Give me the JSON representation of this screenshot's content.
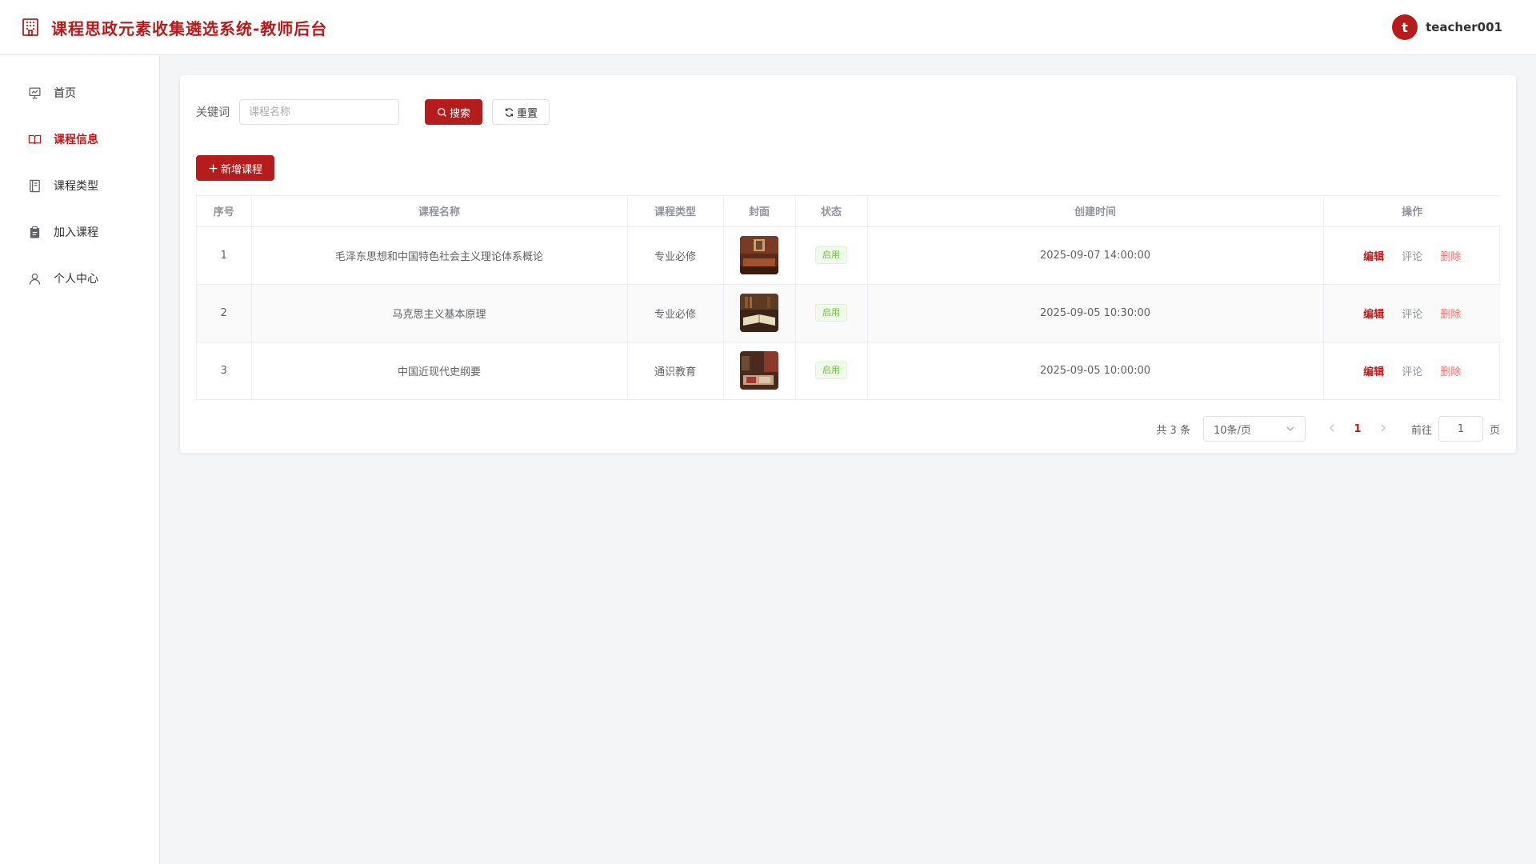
{
  "header": {
    "title": "课程思政元素收集遴选系统-教师后台",
    "avatar_letter": "t",
    "username": "teacher001"
  },
  "sidebar": {
    "items": [
      {
        "label": "首页",
        "icon": "presentation-icon",
        "active": false
      },
      {
        "label": "课程信息",
        "icon": "book-open-icon",
        "active": true
      },
      {
        "label": "课程类型",
        "icon": "notebook-icon",
        "active": false
      },
      {
        "label": "加入课程",
        "icon": "clipboard-icon",
        "active": false
      },
      {
        "label": "个人中心",
        "icon": "user-icon",
        "active": false
      }
    ]
  },
  "search": {
    "label": "关键词",
    "placeholder": "课程名称",
    "value": "",
    "search_button": "搜索",
    "reset_button": "重置"
  },
  "actions": {
    "add_button": "新增课程"
  },
  "table": {
    "headers": [
      "序号",
      "课程名称",
      "课程类型",
      "封面",
      "状态",
      "创建时间",
      "操作"
    ],
    "rows": [
      {
        "index": "1",
        "name": "毛泽东思想和中国特色社会主义理论体系概论",
        "type": "专业必修",
        "status": "启用",
        "created": "2025-09-07 14:00:00"
      },
      {
        "index": "2",
        "name": "马克思主义基本原理",
        "type": "专业必修",
        "status": "启用",
        "created": "2025-09-05 10:30:00"
      },
      {
        "index": "3",
        "name": "中国近现代史纲要",
        "type": "通识教育",
        "status": "启用",
        "created": "2025-09-05 10:00:00"
      }
    ],
    "ops": {
      "edit": "编辑",
      "comment": "评论",
      "delete": "删除"
    }
  },
  "pagination": {
    "total": "共 3 条",
    "page_size": "10条/页",
    "current_page": "1",
    "jump_label": "前往",
    "jump_value": "1",
    "page_suffix": "页"
  },
  "colors": {
    "accent": "#b71c1c",
    "success": "#67c23a",
    "danger": "#f56c6c"
  }
}
